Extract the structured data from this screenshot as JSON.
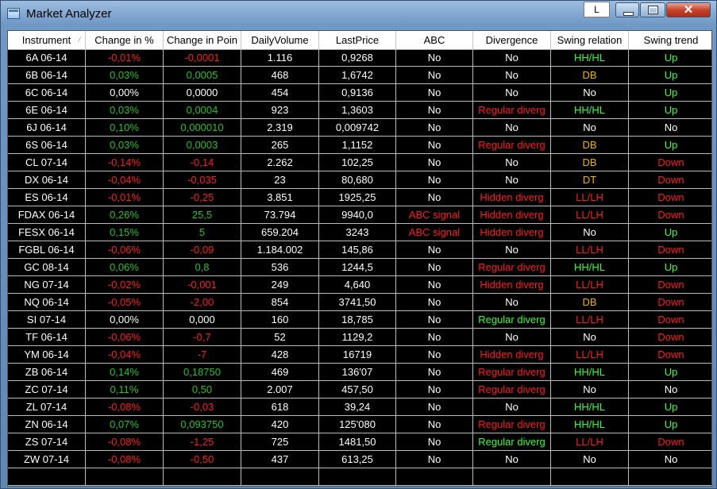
{
  "window": {
    "title": "Market Analyzer",
    "l_button": "L",
    "close_symbol": "✕"
  },
  "columns": [
    "Instrument",
    "Change in %",
    "Change in Poin",
    "DailyVolume",
    "LastPrice",
    "ABC",
    "Divergence",
    "Swing relation",
    "Swing trend"
  ],
  "colors": {
    "red": "#ff1a1a",
    "green": "#22c222",
    "white": "#ffffff",
    "orange": "#f0b400",
    "lime": "#33ff33",
    "bright_green": "#33ff33"
  },
  "rows": [
    {
      "cells": [
        "6A 06-14",
        "-0,01%",
        "-0,0001",
        "1.116",
        "0,9268",
        "No",
        "No",
        "HH/HL",
        "Up"
      ],
      "colors": [
        "white",
        "red",
        "red",
        "white",
        "white",
        "white",
        "white",
        "lime",
        "lime"
      ]
    },
    {
      "cells": [
        "6B 06-14",
        "0,03%",
        "0,0005",
        "468",
        "1,6742",
        "No",
        "No",
        "DB",
        "Up"
      ],
      "colors": [
        "white",
        "green",
        "green",
        "white",
        "white",
        "white",
        "white",
        "orange",
        "lime"
      ]
    },
    {
      "cells": [
        "6C 06-14",
        "0,00%",
        "0,0000",
        "454",
        "0,9136",
        "No",
        "No",
        "No",
        "Up"
      ],
      "colors": [
        "white",
        "white",
        "white",
        "white",
        "white",
        "white",
        "white",
        "white",
        "lime"
      ]
    },
    {
      "cells": [
        "6E 06-14",
        "0,03%",
        "0,0004",
        "923",
        "1,3603",
        "No",
        "Regular diverg",
        "HH/HL",
        "Up"
      ],
      "colors": [
        "white",
        "green",
        "green",
        "white",
        "white",
        "white",
        "red",
        "lime",
        "lime"
      ]
    },
    {
      "cells": [
        "6J 06-14",
        "0,10%",
        "0,000010",
        "2.319",
        "0,009742",
        "No",
        "No",
        "No",
        "No"
      ],
      "colors": [
        "white",
        "green",
        "green",
        "white",
        "white",
        "white",
        "white",
        "white",
        "white"
      ]
    },
    {
      "cells": [
        "6S 06-14",
        "0,03%",
        "0,0003",
        "265",
        "1,1152",
        "No",
        "Regular diverg",
        "DB",
        "Up"
      ],
      "colors": [
        "white",
        "green",
        "green",
        "white",
        "white",
        "white",
        "red",
        "orange",
        "lime"
      ]
    },
    {
      "cells": [
        "CL 07-14",
        "-0,14%",
        "-0,14",
        "2.262",
        "102,25",
        "No",
        "No",
        "DB",
        "Down"
      ],
      "colors": [
        "white",
        "red",
        "red",
        "white",
        "white",
        "white",
        "white",
        "orange",
        "red"
      ]
    },
    {
      "cells": [
        "DX 06-14",
        "-0,04%",
        "-0,035",
        "23",
        "80,680",
        "No",
        "No",
        "DT",
        "Down"
      ],
      "colors": [
        "white",
        "red",
        "red",
        "white",
        "white",
        "white",
        "white",
        "orange",
        "red"
      ]
    },
    {
      "cells": [
        "ES 06-14",
        "-0,01%",
        "-0,25",
        "3.851",
        "1925,25",
        "No",
        "Hidden diverg",
        "LL/LH",
        "Down"
      ],
      "colors": [
        "white",
        "red",
        "red",
        "white",
        "white",
        "white",
        "red",
        "red",
        "red"
      ]
    },
    {
      "cells": [
        "FDAX 06-14",
        "0,26%",
        "25,5",
        "73.794",
        "9940,0",
        "ABC signal",
        "Hidden diverg",
        "LL/LH",
        "Down"
      ],
      "colors": [
        "white",
        "green",
        "green",
        "white",
        "white",
        "red",
        "red",
        "red",
        "red"
      ]
    },
    {
      "cells": [
        "FESX 06-14",
        "0,15%",
        "5",
        "659.204",
        "3243",
        "ABC signal",
        "Hidden diverg",
        "No",
        "Up"
      ],
      "colors": [
        "white",
        "green",
        "green",
        "white",
        "white",
        "red",
        "red",
        "white",
        "lime"
      ]
    },
    {
      "cells": [
        "FGBL 06-14",
        "-0,06%",
        "-0,09",
        "1.184.002",
        "145,86",
        "No",
        "No",
        "LL/LH",
        "Down"
      ],
      "colors": [
        "white",
        "red",
        "red",
        "white",
        "white",
        "white",
        "white",
        "red",
        "red"
      ]
    },
    {
      "cells": [
        "GC 08-14",
        "0,06%",
        "0,8",
        "536",
        "1244,5",
        "No",
        "Regular diverg",
        "HH/HL",
        "Up"
      ],
      "colors": [
        "white",
        "green",
        "green",
        "white",
        "white",
        "white",
        "red",
        "lime",
        "lime"
      ]
    },
    {
      "cells": [
        "NG 07-14",
        "-0,02%",
        "-0,001",
        "249",
        "4,640",
        "No",
        "Hidden diverg",
        "LL/LH",
        "Down"
      ],
      "colors": [
        "white",
        "red",
        "red",
        "white",
        "white",
        "white",
        "red",
        "red",
        "red"
      ]
    },
    {
      "cells": [
        "NQ 06-14",
        "-0,05%",
        "-2,00",
        "854",
        "3741,50",
        "No",
        "No",
        "DB",
        "Down"
      ],
      "colors": [
        "white",
        "red",
        "red",
        "white",
        "white",
        "white",
        "white",
        "orange",
        "red"
      ]
    },
    {
      "cells": [
        "SI 07-14",
        "0,00%",
        "0,000",
        "160",
        "18,785",
        "No",
        "Regular diverg",
        "LL/LH",
        "Down"
      ],
      "colors": [
        "white",
        "white",
        "white",
        "white",
        "white",
        "white",
        "bright_green",
        "red",
        "red"
      ]
    },
    {
      "cells": [
        "TF 06-14",
        "-0,06%",
        "-0,7",
        "52",
        "1129,2",
        "No",
        "No",
        "No",
        "Down"
      ],
      "colors": [
        "white",
        "red",
        "red",
        "white",
        "white",
        "white",
        "white",
        "white",
        "red"
      ]
    },
    {
      "cells": [
        "YM 06-14",
        "-0,04%",
        "-7",
        "428",
        "16719",
        "No",
        "Hidden diverg",
        "LL/LH",
        "Down"
      ],
      "colors": [
        "white",
        "red",
        "red",
        "white",
        "white",
        "white",
        "red",
        "red",
        "red"
      ]
    },
    {
      "cells": [
        "ZB 06-14",
        "0,14%",
        "0,18750",
        "469",
        "136'07",
        "No",
        "Regular diverg",
        "HH/HL",
        "Up"
      ],
      "colors": [
        "white",
        "green",
        "green",
        "white",
        "white",
        "white",
        "red",
        "lime",
        "lime"
      ]
    },
    {
      "cells": [
        "ZC 07-14",
        "0,11%",
        "0,50",
        "2.007",
        "457,50",
        "No",
        "Regular diverg",
        "No",
        "No"
      ],
      "colors": [
        "white",
        "green",
        "green",
        "white",
        "white",
        "white",
        "red",
        "white",
        "white"
      ]
    },
    {
      "cells": [
        "ZL 07-14",
        "-0,08%",
        "-0,03",
        "618",
        "39,24",
        "No",
        "No",
        "HH/HL",
        "Up"
      ],
      "colors": [
        "white",
        "red",
        "red",
        "white",
        "white",
        "white",
        "white",
        "lime",
        "lime"
      ]
    },
    {
      "cells": [
        "ZN 06-14",
        "0,07%",
        "0,093750",
        "420",
        "125'080",
        "No",
        "Regular diverg",
        "HH/HL",
        "Up"
      ],
      "colors": [
        "white",
        "green",
        "green",
        "white",
        "white",
        "white",
        "red",
        "lime",
        "lime"
      ]
    },
    {
      "cells": [
        "ZS 07-14",
        "-0,08%",
        "-1,25",
        "725",
        "1481,50",
        "No",
        "Regular diverg",
        "LL/LH",
        "Down"
      ],
      "colors": [
        "white",
        "red",
        "red",
        "white",
        "white",
        "white",
        "bright_green",
        "red",
        "red"
      ]
    },
    {
      "cells": [
        "ZW 07-14",
        "-0,08%",
        "-0,50",
        "437",
        "613,25",
        "No",
        "No",
        "No",
        "No"
      ],
      "colors": [
        "white",
        "red",
        "red",
        "white",
        "white",
        "white",
        "white",
        "white",
        "white"
      ]
    }
  ]
}
